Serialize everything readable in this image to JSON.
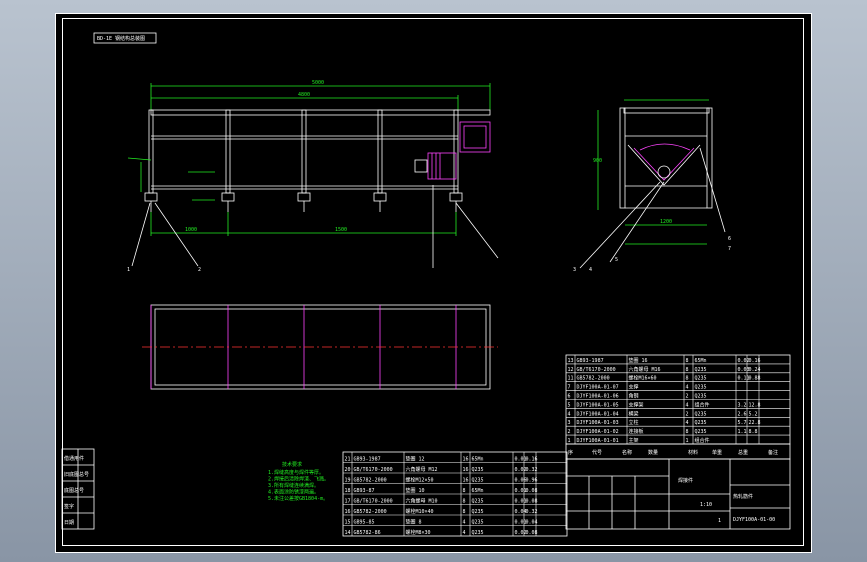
{
  "drawing": {
    "view_label": "BD-1E 钢结构总装图",
    "title_block": {
      "part_name": "焊接件",
      "drawing_name": "热轧筋件",
      "drawing_no": "DJYF100A-01-00",
      "scale": "1:10",
      "sheet": "1"
    },
    "bom_header": [
      "序",
      "代号",
      "名称",
      "数量",
      "材料",
      "单重",
      "总重",
      "备注"
    ],
    "bom_upper": [
      [
        "13",
        "GB93-1987",
        "垫圈 16",
        "8",
        "65Mn",
        "0.02",
        "0.16"
      ],
      [
        "12",
        "GB/T6170-2000",
        "六角螺母 M16",
        "8",
        "Q235",
        "0.03",
        "0.24"
      ],
      [
        "11",
        "GB5782-2000",
        "螺栓M16×60",
        "8",
        "Q235",
        "0.11",
        "0.88"
      ],
      [
        "7",
        "DJYF100A-01-07",
        "支撑",
        "4",
        "Q235",
        "",
        ""
      ],
      [
        "6",
        "DJYF100A-01-06",
        "角钢",
        "2",
        "Q235",
        "",
        ""
      ],
      [
        "5",
        "DJYF100A-01-05",
        "支撑架",
        "4",
        "组合件",
        "3.2",
        "12.8"
      ],
      [
        "4",
        "DJYF100A-01-04",
        "横梁",
        "2",
        "Q235",
        "2.6",
        "5.2"
      ],
      [
        "3",
        "DJYF100A-01-03",
        "立柱",
        "4",
        "Q235",
        "5.7",
        "22.8"
      ],
      [
        "2",
        "DJYF100A-01-02",
        "连接板",
        "8",
        "Q235",
        "1.1",
        "8.8"
      ],
      [
        "1",
        "DJYF100A-01-01",
        "主架",
        "1",
        "组合件",
        "",
        ""
      ]
    ],
    "bom_lower": [
      [
        "21",
        "GB93-1987",
        "垫圈 12",
        "16",
        "65Mn",
        "0.01",
        "0.16"
      ],
      [
        "20",
        "GB/T6170-2000",
        "六角螺母 M12",
        "16",
        "Q235",
        "0.02",
        "0.32"
      ],
      [
        "19",
        "GB5782-2000",
        "螺栓M12×50",
        "16",
        "Q235",
        "0.06",
        "0.96"
      ],
      [
        "18",
        "GB93-87",
        "垫圈 10",
        "8",
        "65Mn",
        "0.01",
        "0.08"
      ],
      [
        "17",
        "GB/T6170-2000",
        "六角螺母 M10",
        "8",
        "Q235",
        "0.01",
        "0.08"
      ],
      [
        "16",
        "GB5782-2000",
        "螺栓M10×40",
        "8",
        "Q235",
        "0.04",
        "0.32"
      ],
      [
        "15",
        "GB95-85",
        "垫圈 8",
        "4",
        "Q235",
        "0.01",
        "0.04"
      ],
      [
        "14",
        "GB5782-86",
        "螺栓M8×30",
        "4",
        "Q235",
        "0.02",
        "0.08"
      ]
    ],
    "notes_title": "技术要求",
    "notes": [
      "1.焊缝高度与焊件等厚。",
      "2.焊接后清除焊渣、飞溅。",
      "3.所有焊缝连续满焊。",
      "4.表面涂防锈漆两遍。",
      "5.未注公差按GB1804-m。"
    ],
    "left_strip": [
      "借通用件",
      "旧底图总号",
      "底图总号",
      "签字",
      "日期"
    ],
    "dims": {
      "overall_length": "5000",
      "inner_length": "4800",
      "bay_1": "1000",
      "bay_2": "1500",
      "side_width": "1200",
      "side_height": "900"
    },
    "callouts": [
      "1",
      "2",
      "3",
      "4",
      "5",
      "6",
      "7"
    ],
    "colors": {
      "sheet": "#000000",
      "outline": "#ffffff",
      "dimension": "#22ee22",
      "motor": "#ff44ff",
      "centerline": "#ff3333"
    }
  }
}
